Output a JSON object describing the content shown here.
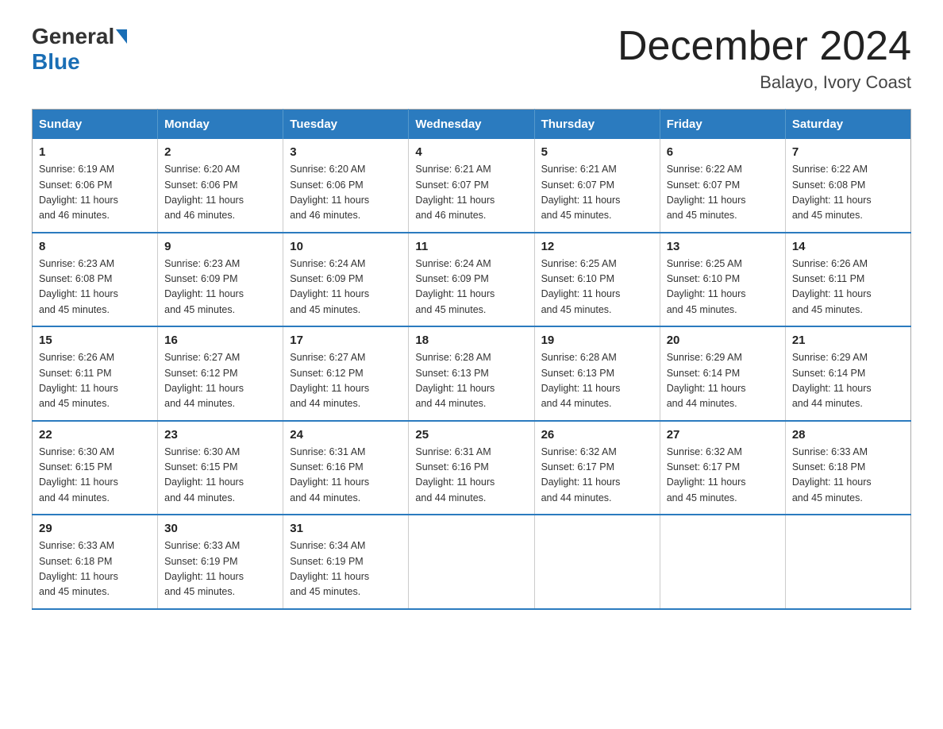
{
  "header": {
    "logo_general": "General",
    "logo_blue": "Blue",
    "month_title": "December 2024",
    "location": "Balayo, Ivory Coast"
  },
  "days_of_week": [
    "Sunday",
    "Monday",
    "Tuesday",
    "Wednesday",
    "Thursday",
    "Friday",
    "Saturday"
  ],
  "weeks": [
    [
      {
        "day": "1",
        "sunrise": "6:19 AM",
        "sunset": "6:06 PM",
        "daylight": "11 hours and 46 minutes."
      },
      {
        "day": "2",
        "sunrise": "6:20 AM",
        "sunset": "6:06 PM",
        "daylight": "11 hours and 46 minutes."
      },
      {
        "day": "3",
        "sunrise": "6:20 AM",
        "sunset": "6:06 PM",
        "daylight": "11 hours and 46 minutes."
      },
      {
        "day": "4",
        "sunrise": "6:21 AM",
        "sunset": "6:07 PM",
        "daylight": "11 hours and 46 minutes."
      },
      {
        "day": "5",
        "sunrise": "6:21 AM",
        "sunset": "6:07 PM",
        "daylight": "11 hours and 45 minutes."
      },
      {
        "day": "6",
        "sunrise": "6:22 AM",
        "sunset": "6:07 PM",
        "daylight": "11 hours and 45 minutes."
      },
      {
        "day": "7",
        "sunrise": "6:22 AM",
        "sunset": "6:08 PM",
        "daylight": "11 hours and 45 minutes."
      }
    ],
    [
      {
        "day": "8",
        "sunrise": "6:23 AM",
        "sunset": "6:08 PM",
        "daylight": "11 hours and 45 minutes."
      },
      {
        "day": "9",
        "sunrise": "6:23 AM",
        "sunset": "6:09 PM",
        "daylight": "11 hours and 45 minutes."
      },
      {
        "day": "10",
        "sunrise": "6:24 AM",
        "sunset": "6:09 PM",
        "daylight": "11 hours and 45 minutes."
      },
      {
        "day": "11",
        "sunrise": "6:24 AM",
        "sunset": "6:09 PM",
        "daylight": "11 hours and 45 minutes."
      },
      {
        "day": "12",
        "sunrise": "6:25 AM",
        "sunset": "6:10 PM",
        "daylight": "11 hours and 45 minutes."
      },
      {
        "day": "13",
        "sunrise": "6:25 AM",
        "sunset": "6:10 PM",
        "daylight": "11 hours and 45 minutes."
      },
      {
        "day": "14",
        "sunrise": "6:26 AM",
        "sunset": "6:11 PM",
        "daylight": "11 hours and 45 minutes."
      }
    ],
    [
      {
        "day": "15",
        "sunrise": "6:26 AM",
        "sunset": "6:11 PM",
        "daylight": "11 hours and 45 minutes."
      },
      {
        "day": "16",
        "sunrise": "6:27 AM",
        "sunset": "6:12 PM",
        "daylight": "11 hours and 44 minutes."
      },
      {
        "day": "17",
        "sunrise": "6:27 AM",
        "sunset": "6:12 PM",
        "daylight": "11 hours and 44 minutes."
      },
      {
        "day": "18",
        "sunrise": "6:28 AM",
        "sunset": "6:13 PM",
        "daylight": "11 hours and 44 minutes."
      },
      {
        "day": "19",
        "sunrise": "6:28 AM",
        "sunset": "6:13 PM",
        "daylight": "11 hours and 44 minutes."
      },
      {
        "day": "20",
        "sunrise": "6:29 AM",
        "sunset": "6:14 PM",
        "daylight": "11 hours and 44 minutes."
      },
      {
        "day": "21",
        "sunrise": "6:29 AM",
        "sunset": "6:14 PM",
        "daylight": "11 hours and 44 minutes."
      }
    ],
    [
      {
        "day": "22",
        "sunrise": "6:30 AM",
        "sunset": "6:15 PM",
        "daylight": "11 hours and 44 minutes."
      },
      {
        "day": "23",
        "sunrise": "6:30 AM",
        "sunset": "6:15 PM",
        "daylight": "11 hours and 44 minutes."
      },
      {
        "day": "24",
        "sunrise": "6:31 AM",
        "sunset": "6:16 PM",
        "daylight": "11 hours and 44 minutes."
      },
      {
        "day": "25",
        "sunrise": "6:31 AM",
        "sunset": "6:16 PM",
        "daylight": "11 hours and 44 minutes."
      },
      {
        "day": "26",
        "sunrise": "6:32 AM",
        "sunset": "6:17 PM",
        "daylight": "11 hours and 44 minutes."
      },
      {
        "day": "27",
        "sunrise": "6:32 AM",
        "sunset": "6:17 PM",
        "daylight": "11 hours and 45 minutes."
      },
      {
        "day": "28",
        "sunrise": "6:33 AM",
        "sunset": "6:18 PM",
        "daylight": "11 hours and 45 minutes."
      }
    ],
    [
      {
        "day": "29",
        "sunrise": "6:33 AM",
        "sunset": "6:18 PM",
        "daylight": "11 hours and 45 minutes."
      },
      {
        "day": "30",
        "sunrise": "6:33 AM",
        "sunset": "6:19 PM",
        "daylight": "11 hours and 45 minutes."
      },
      {
        "day": "31",
        "sunrise": "6:34 AM",
        "sunset": "6:19 PM",
        "daylight": "11 hours and 45 minutes."
      },
      null,
      null,
      null,
      null
    ]
  ],
  "labels": {
    "sunrise": "Sunrise:",
    "sunset": "Sunset:",
    "daylight": "Daylight:"
  }
}
